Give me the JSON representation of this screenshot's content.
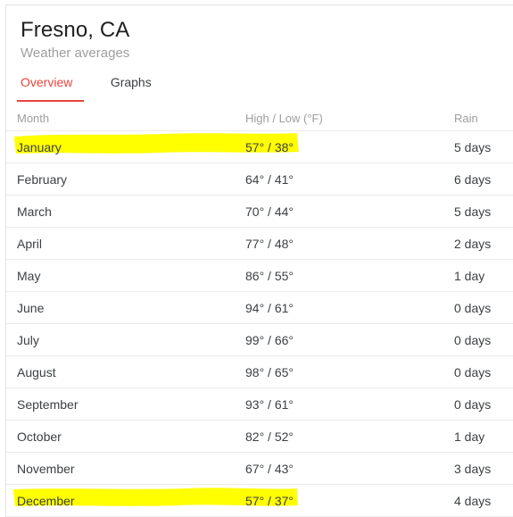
{
  "header": {
    "title": "Fresno, CA",
    "subtitle": "Weather averages"
  },
  "tabs": [
    {
      "label": "Overview",
      "active": true
    },
    {
      "label": "Graphs",
      "active": false
    }
  ],
  "table": {
    "columns": [
      "Month",
      "High / Low (°F)",
      "Rain"
    ],
    "rows": [
      {
        "month": "January",
        "temp": "57° / 38°",
        "rain": "5 days",
        "highlighted": true
      },
      {
        "month": "February",
        "temp": "64° / 41°",
        "rain": "6 days",
        "highlighted": false
      },
      {
        "month": "March",
        "temp": "70° / 44°",
        "rain": "5 days",
        "highlighted": false
      },
      {
        "month": "April",
        "temp": "77° / 48°",
        "rain": "2 days",
        "highlighted": false
      },
      {
        "month": "May",
        "temp": "86° / 55°",
        "rain": "1 day",
        "highlighted": false
      },
      {
        "month": "June",
        "temp": "94° / 61°",
        "rain": "0 days",
        "highlighted": false
      },
      {
        "month": "July",
        "temp": "99° / 66°",
        "rain": "0 days",
        "highlighted": false
      },
      {
        "month": "August",
        "temp": "98° / 65°",
        "rain": "0 days",
        "highlighted": false
      },
      {
        "month": "September",
        "temp": "93° / 61°",
        "rain": "0 days",
        "highlighted": false
      },
      {
        "month": "October",
        "temp": "82° / 52°",
        "rain": "1 day",
        "highlighted": false
      },
      {
        "month": "November",
        "temp": "67° / 43°",
        "rain": "3 days",
        "highlighted": false
      },
      {
        "month": "December",
        "temp": "57° / 37°",
        "rain": "4 days",
        "highlighted": true
      }
    ]
  },
  "annotations": {
    "highlight_color": "#ffff00",
    "highlighted_months": [
      "January",
      "December"
    ]
  },
  "colors": {
    "accent": "#e8453c",
    "text": "#3c4043",
    "muted": "#9e9e9e",
    "title": "#212121",
    "rule": "#ececec"
  }
}
